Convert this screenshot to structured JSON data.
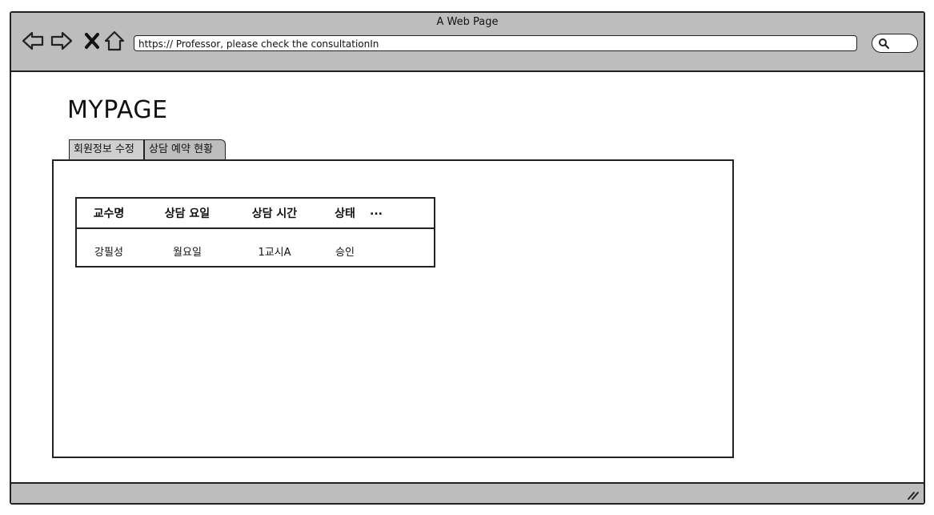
{
  "browser": {
    "title": "A Web Page",
    "url": "https:// Professor, please check the consultationIn",
    "icons": [
      "back-arrow-icon",
      "forward-arrow-icon",
      "close-x-icon",
      "home-icon",
      "search-icon"
    ]
  },
  "page": {
    "title": "MYPAGE",
    "tabs": [
      {
        "label": "회원정보 수정"
      },
      {
        "label": "상담 예약 현황"
      }
    ]
  },
  "table": {
    "headers": [
      "교수명",
      "상담 요일",
      "상담 시간",
      "상태",
      "..."
    ],
    "rows": [
      [
        "강필성",
        "월요일",
        "1교시A",
        "승인"
      ]
    ]
  }
}
